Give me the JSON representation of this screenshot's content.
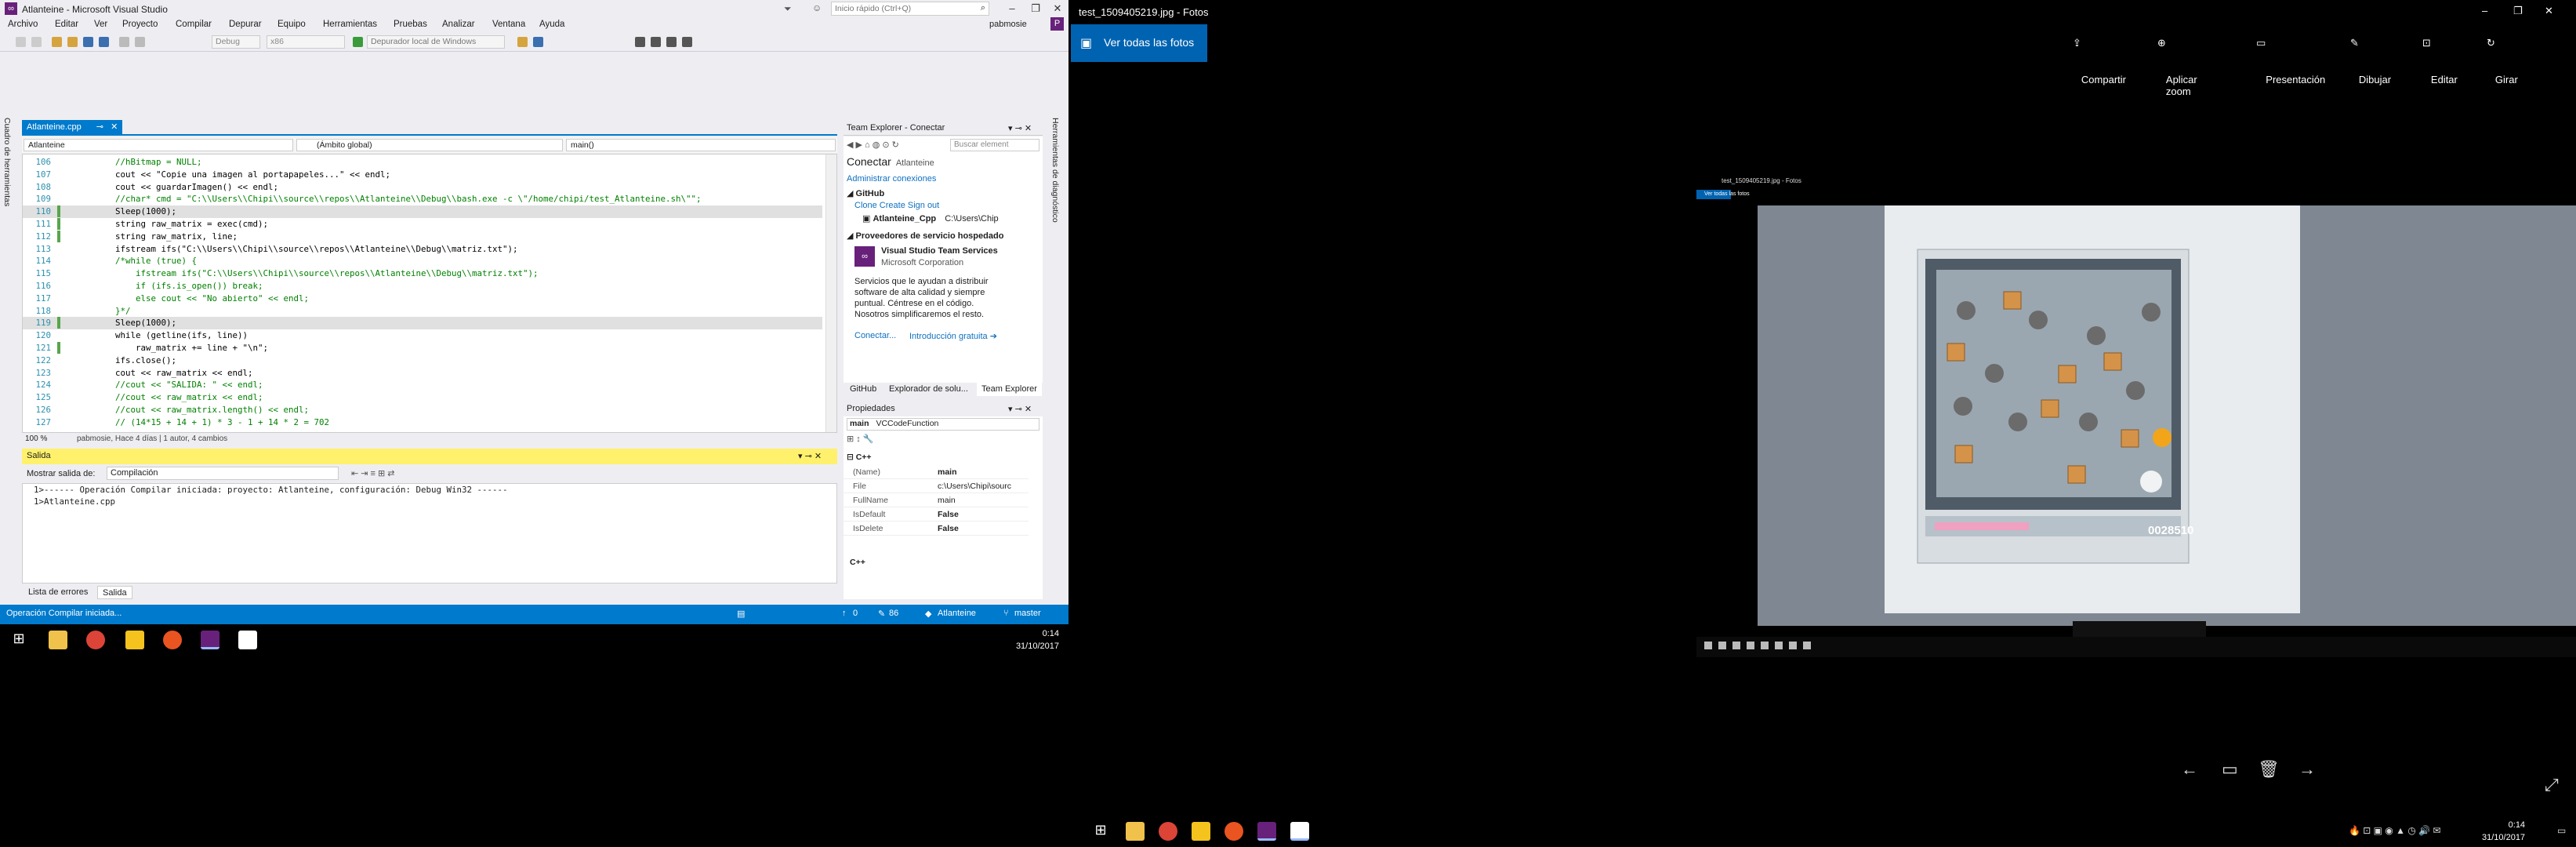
{
  "vs": {
    "title": "Atlanteine - Microsoft Visual Studio",
    "quick_launch": "Inicio rápido (Ctrl+Q)",
    "user": "pabmosie",
    "user_initial": "P",
    "menu": [
      "Archivo",
      "Editar",
      "Ver",
      "Proyecto",
      "Compilar",
      "Depurar",
      "Equipo",
      "Herramientas",
      "Pruebas",
      "Analizar",
      "Ventana",
      "Ayuda"
    ],
    "toolbar": {
      "config": "Debug",
      "platform": "x86",
      "debugger": "Depurador local de Windows"
    },
    "left_vtabs": [
      "Cuadro de herramientas"
    ],
    "doc_tab": "Atlanteine.cpp",
    "nav": {
      "project": "Atlanteine",
      "scope": "(Ámbito global)",
      "member": "main()"
    },
    "code_lines": [
      {
        "n": "106",
        "t": "        //hBitmap = NULL;",
        "c": ""
      },
      {
        "n": "107",
        "t": "        cout << \"Copie una imagen al portapapeles...\" << endl;",
        "c": ""
      },
      {
        "n": "108",
        "t": "        cout << guardarImagen() << endl;",
        "c": ""
      },
      {
        "n": "109",
        "t": "        //char* cmd = \"C:\\\\Users\\\\Chipi\\\\source\\\\repos\\\\Atlanteine\\\\Debug\\\\bash.exe -c \\\"/home/chipi/test_Atlanteine.sh\\\"\";",
        "c": ""
      },
      {
        "n": "110",
        "t": "        Sleep(1000);",
        "c": "g"
      },
      {
        "n": "111",
        "t": "        string raw_matrix = exec(cmd);",
        "c": "g"
      },
      {
        "n": "112",
        "t": "        string raw_matrix, line;",
        "c": "g"
      },
      {
        "n": "113",
        "t": "        ifstream ifs(\"C:\\\\Users\\\\Chipi\\\\source\\\\repos\\\\Atlanteine\\\\Debug\\\\matriz.txt\");",
        "c": ""
      },
      {
        "n": "114",
        "t": "        /*while (true) {",
        "c": ""
      },
      {
        "n": "115",
        "t": "            ifstream ifs(\"C:\\\\Users\\\\Chipi\\\\source\\\\repos\\\\Atlanteine\\\\Debug\\\\matriz.txt\");",
        "c": ""
      },
      {
        "n": "116",
        "t": "            if (ifs.is_open()) break;",
        "c": ""
      },
      {
        "n": "117",
        "t": "            else cout << \"No abierto\" << endl;",
        "c": ""
      },
      {
        "n": "118",
        "t": "        }*/",
        "c": ""
      },
      {
        "n": "119",
        "t": "        Sleep(1000);",
        "c": "g"
      },
      {
        "n": "120",
        "t": "        while (getline(ifs, line))",
        "c": ""
      },
      {
        "n": "121",
        "t": "            raw_matrix += line + \"\\n\";",
        "c": "g"
      },
      {
        "n": "122",
        "t": "        ifs.close();",
        "c": ""
      },
      {
        "n": "123",
        "t": "        cout << raw_matrix << endl;",
        "c": ""
      },
      {
        "n": "124",
        "t": "        //cout << \"SALIDA: \" << endl;",
        "c": ""
      },
      {
        "n": "125",
        "t": "        //cout << raw_matrix << endl;",
        "c": ""
      },
      {
        "n": "126",
        "t": "        //cout << raw_matrix.length() << endl;",
        "c": ""
      },
      {
        "n": "127",
        "t": "        // (14*15 + 14 + 1) * 3 - 1 + 14 * 2 = 702",
        "c": ""
      }
    ],
    "editor_status": {
      "zoom": "100 %",
      "author": "pabmosie, Hace 4 días | 1 autor, 4 cambios"
    },
    "output": {
      "title": "Salida",
      "show_from_label": "Mostrar salida de:",
      "source": "Compilación",
      "lines": [
        "1>------ Operación Compilar iniciada: proyecto: Atlanteine, configuración: Debug Win32 ------",
        "1>Atlanteine.cpp"
      ],
      "tabs": [
        "Lista de errores",
        "Salida"
      ]
    },
    "team_explorer": {
      "title": "Team Explorer - Conectar",
      "search": "Buscar element",
      "heading": "Conectar",
      "heading_sub": "Atlanteine",
      "manage": "Administrar conexiones",
      "github": "GitHub",
      "github_links": "Clone  Create  Sign out",
      "repo": "Atlanteine_Cpp",
      "repo_path": "C:\\Users\\Chip",
      "hosted": "Proveedores de servicio hospedado",
      "vsts_title": "Visual Studio Team Services",
      "vsts_corp": "Microsoft Corporation",
      "vsts_desc": "Servicios que le ayudan a distribuir software de alta calidad y siempre puntual. Céntrese en el código. Nosotros simplificaremos el resto.",
      "connect": "Conectar...",
      "intro": "Introducción gratuita",
      "tabs": [
        "GitHub",
        "Explorador de solu...",
        "Team Explorer"
      ]
    },
    "properties": {
      "title": "Propiedades",
      "object": "main",
      "object_type": "VCCodeFunction",
      "category": "C++",
      "rows": [
        {
          "k": "(Name)",
          "v": "main"
        },
        {
          "k": "File",
          "v": "c:\\Users\\Chipi\\sourc"
        },
        {
          "k": "FullName",
          "v": "main"
        },
        {
          "k": "IsDefault",
          "v": "False"
        },
        {
          "k": "IsDelete",
          "v": "False"
        }
      ],
      "footer": "C++"
    },
    "right_vtab": "Herramientas de diagnóstico",
    "status": {
      "message": "Operación Compilar iniciada...",
      "up": "0",
      "edits": "86",
      "repo": "Atlanteine",
      "branch": "master"
    },
    "clock": {
      "time": "0:14",
      "date": "31/10/2017"
    }
  },
  "photos": {
    "title": "test_1509405219.jpg - Fotos",
    "back": "Ver todas las fotos",
    "commands": [
      "Compartir",
      "Aplicar zoom",
      "Presentación",
      "Dibujar",
      "Editar",
      "Girar"
    ],
    "inner_title": "test_1509405219.jpg - Fotos",
    "inner_back": "Ver todas las fotos",
    "game_score": "0028510",
    "clock": {
      "time": "0:14",
      "date": "31/10/2017"
    }
  },
  "colors": {
    "vs_accent": "#007acc",
    "vs_purple": "#68217a",
    "photos_blue": "#0063b1",
    "output_header": "#fff16b"
  }
}
